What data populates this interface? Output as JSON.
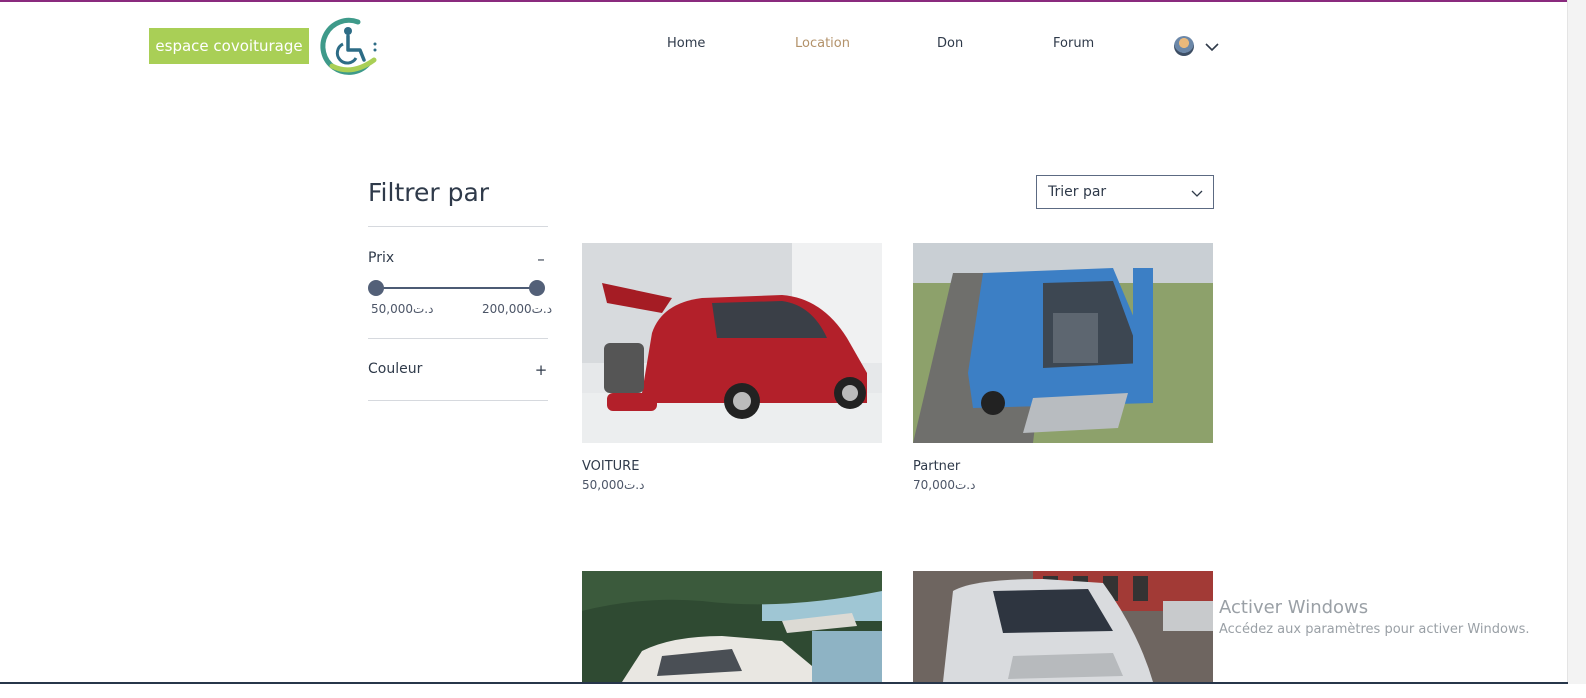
{
  "header": {
    "brand": "espace covoiturage",
    "logo_icon": "wheelchair-logo-icon",
    "nav": [
      {
        "label": "Home",
        "active": false
      },
      {
        "label": "Location",
        "active": true
      },
      {
        "label": "Don",
        "active": false
      },
      {
        "label": "Forum",
        "active": false
      }
    ],
    "avatar_icon": "avatar-icon",
    "chevron_icon": "chevron-down-icon",
    "accent_color": "#b3926a",
    "brand_color": "#a9cf56"
  },
  "filters": {
    "title": "Filtrer par",
    "price": {
      "label": "Prix",
      "toggle": "–",
      "min_label": "50,000د.ت",
      "max_label": "200,000د.ت",
      "range": [
        50000,
        200000
      ]
    },
    "color": {
      "label": "Couleur",
      "toggle": "+"
    }
  },
  "sort": {
    "label": "Trier par",
    "icon": "chevron-down-icon"
  },
  "products": [
    {
      "name": "VOITURE",
      "price": "50,000د.ت",
      "image": "red-van-with-wheelchair-lift"
    },
    {
      "name": "Partner",
      "price": "70,000د.ت",
      "image": "blue-van-with-ramp"
    },
    {
      "name": "",
      "price": "",
      "image": "white-van-by-sea"
    },
    {
      "name": "",
      "price": "",
      "image": "silver-citroen-van"
    }
  ],
  "windows_overlay": {
    "title": "Activer Windows",
    "subtitle": "Accédez aux paramètres pour activer Windows."
  }
}
